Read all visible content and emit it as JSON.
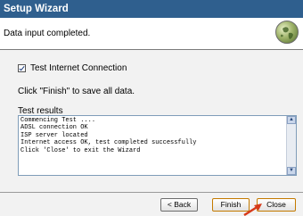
{
  "window": {
    "title": "Setup Wizard"
  },
  "header": {
    "message": "Data input completed.",
    "icon": "globe-icon"
  },
  "content": {
    "checkbox_label": "Test Internet Connection",
    "checkbox_checked": true,
    "finish_note": "Click \"Finish\" to save all data.",
    "results_label": "Test results",
    "results_lines": [
      "Commencing Test ....",
      "ADSL connection OK",
      "ISP server located",
      "Internet access OK, test completed successfully",
      "Click 'Close' to exit the Wizard"
    ]
  },
  "footer": {
    "back_label": "< Back",
    "finish_label": "Finish",
    "close_label": "Close"
  },
  "colors": {
    "titlebar": "#2f5f8e",
    "highlight_button_border": "#c47a00",
    "pointer_arrow": "#d63a1a"
  }
}
